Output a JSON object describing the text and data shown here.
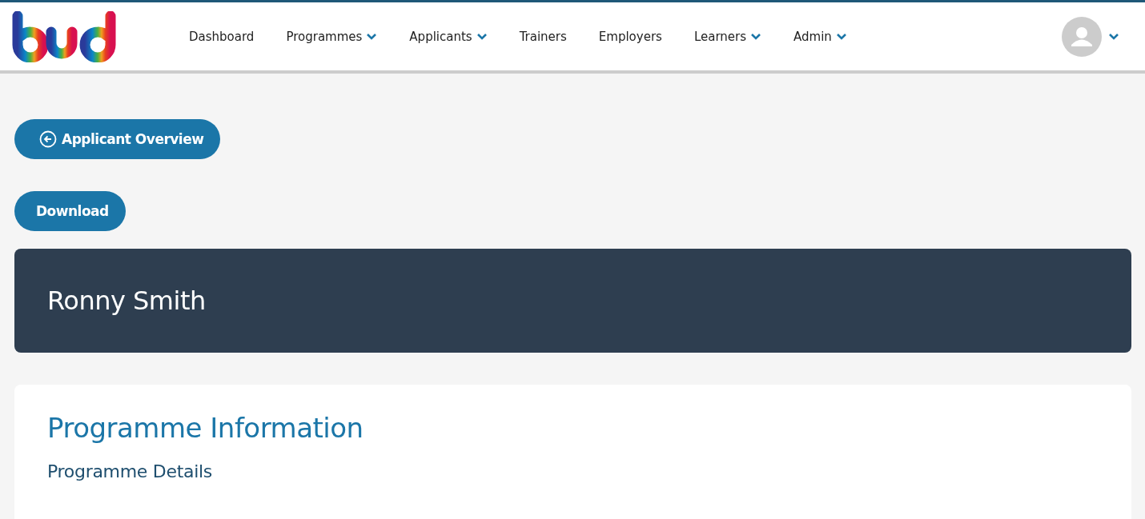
{
  "nav": [
    {
      "label": "Dashboard",
      "dropdown": false
    },
    {
      "label": "Programmes",
      "dropdown": true
    },
    {
      "label": "Applicants",
      "dropdown": true
    },
    {
      "label": "Trainers",
      "dropdown": false
    },
    {
      "label": "Employers",
      "dropdown": false
    },
    {
      "label": "Learners",
      "dropdown": true
    },
    {
      "label": "Admin",
      "dropdown": true
    }
  ],
  "back_button": "Applicant Overview",
  "download_button": "Download",
  "applicant_name": "Ronny Smith",
  "section": {
    "title": "Programme Information",
    "subtitle": "Programme Details"
  }
}
